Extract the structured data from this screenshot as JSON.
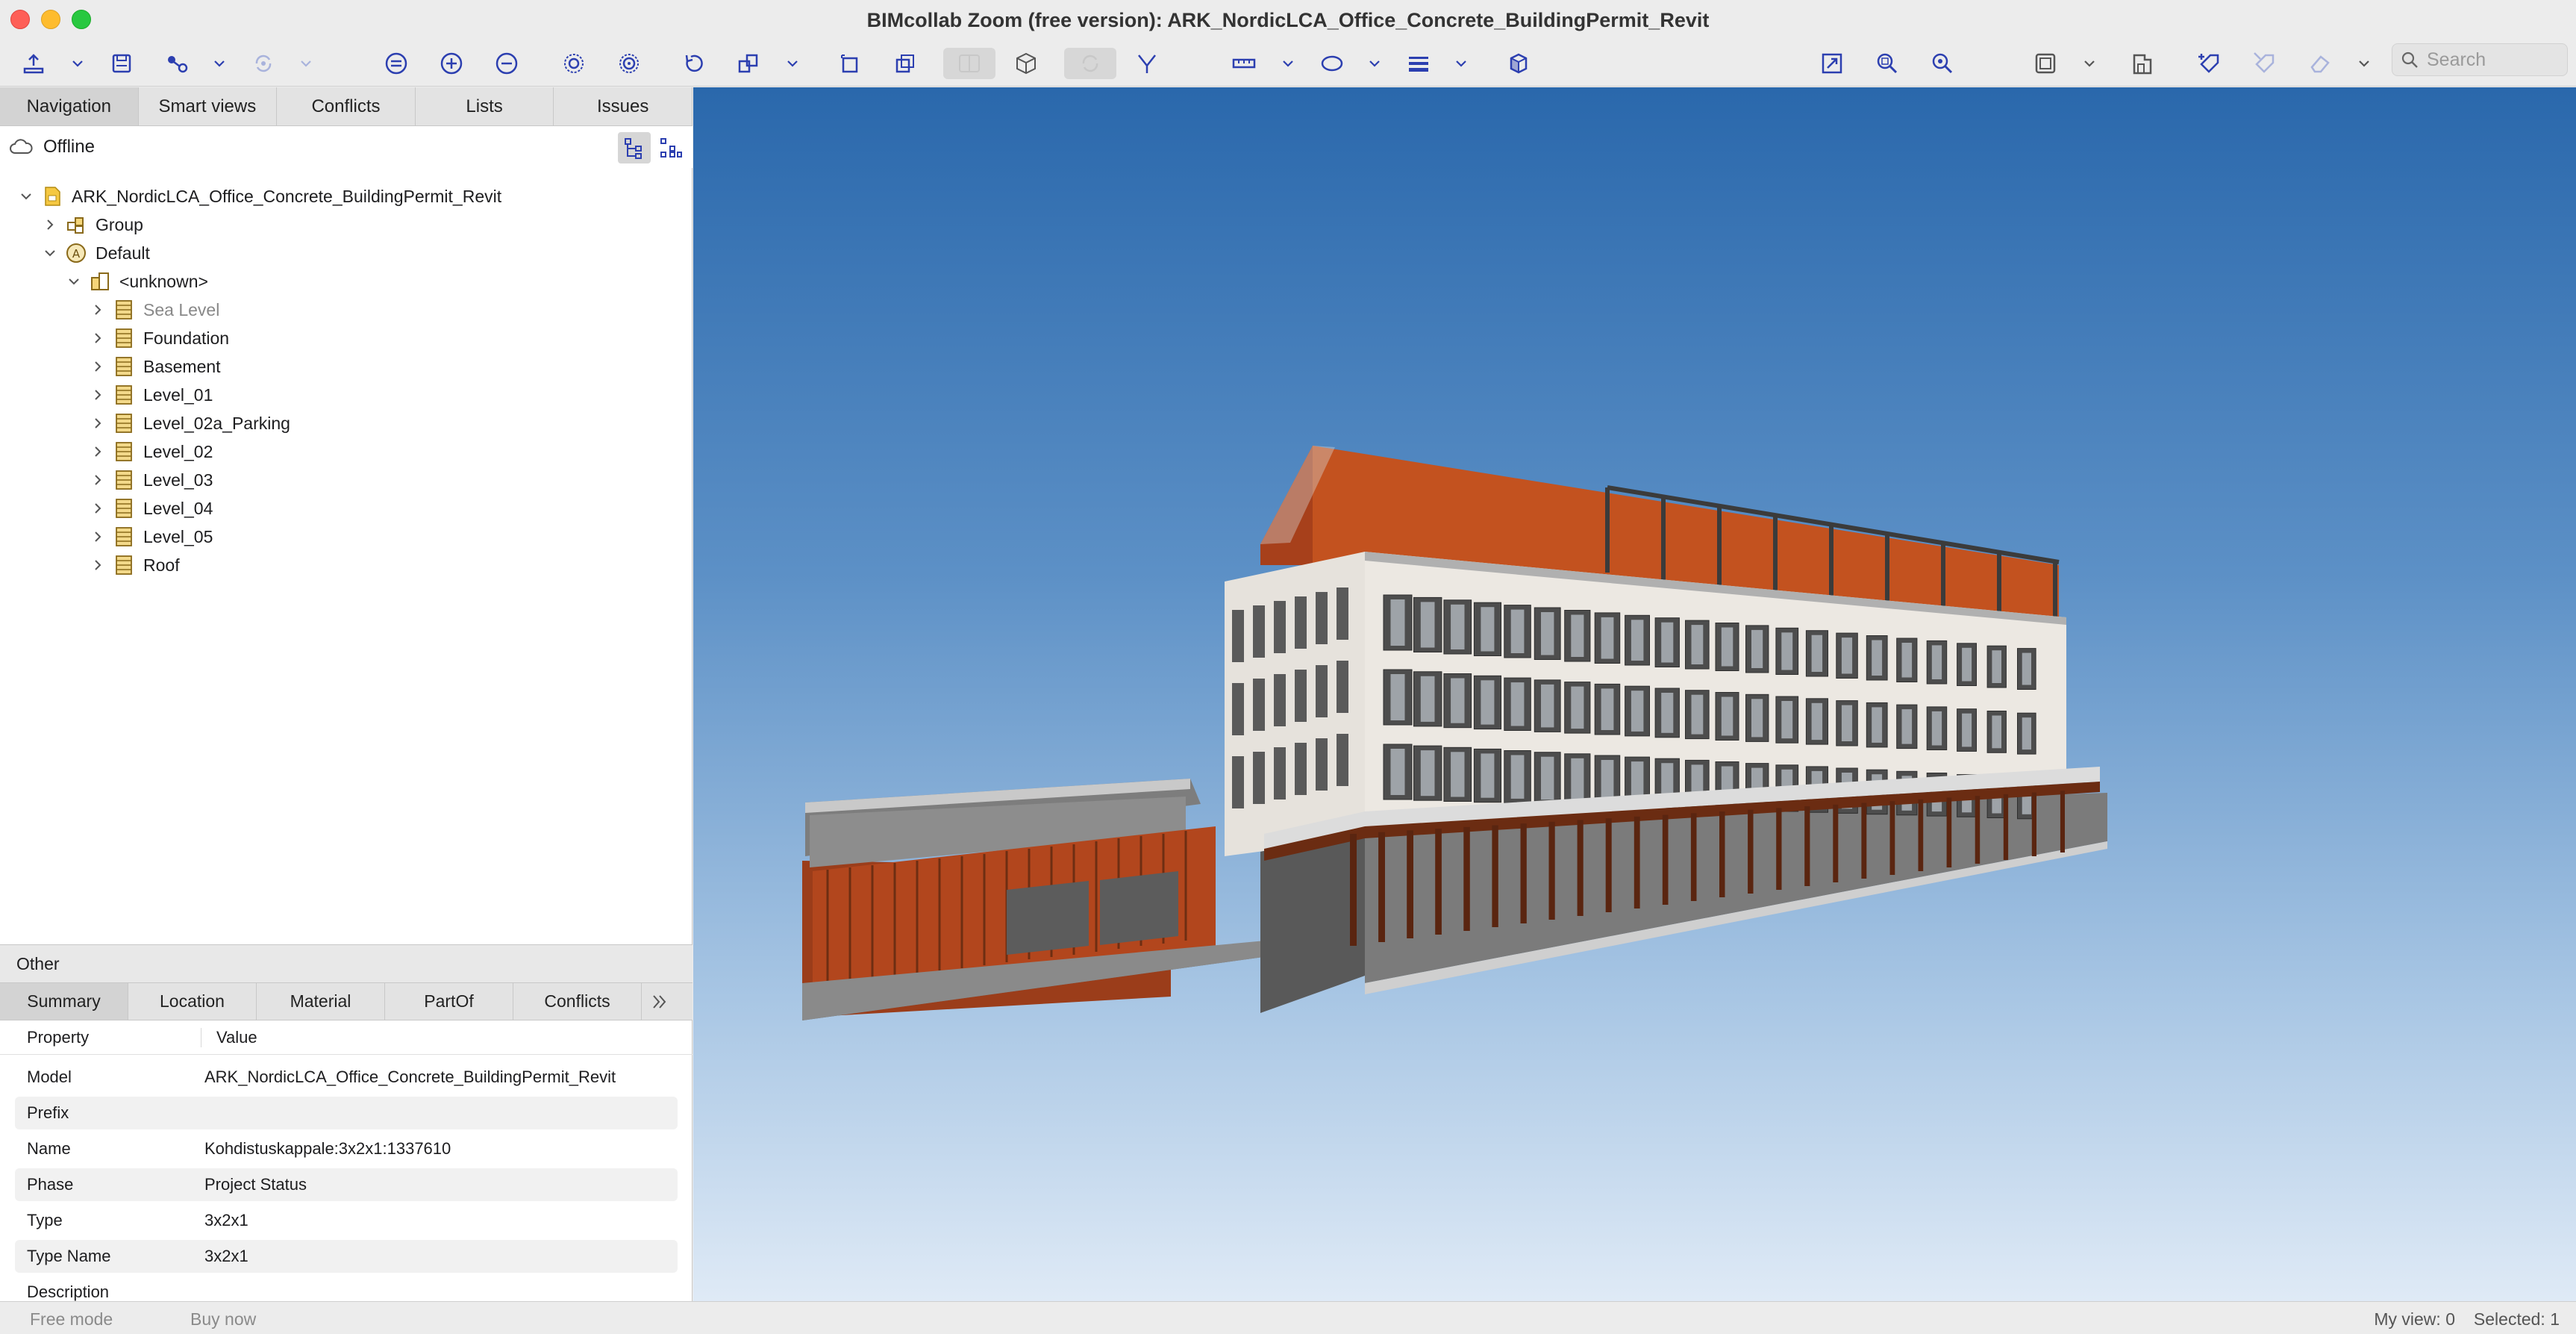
{
  "window": {
    "title": "BIMcollab Zoom (free version): ARK_NordicLCA_Office_Concrete_BuildingPermit_Revit"
  },
  "toolbar": {
    "search_placeholder": "Search",
    "icons": [
      "open-icon",
      "save-icon",
      "connect-icon",
      "sync-icon",
      "visibility-isolate-icon",
      "zoom-in-icon",
      "zoom-out-icon",
      "focus-icon",
      "select-all-icon",
      "reset-icon",
      "layers-icon",
      "box-icon",
      "section-box-icon",
      "plane-icon",
      "cube-icon",
      "orbit-icon",
      "walk-icon",
      "measure-icon",
      "ellipse-icon",
      "lines-icon",
      "render-icon",
      "fullscreen-icon",
      "zoom-selection-icon",
      "zoom-extents-icon",
      "frame-icon",
      "storey-icon",
      "tag-add-icon",
      "tag-remove-icon",
      "erase-icon"
    ]
  },
  "left_panel": {
    "tabs": [
      {
        "label": "Navigation",
        "active": true
      },
      {
        "label": "Smart views",
        "active": false
      },
      {
        "label": "Conflicts",
        "active": false
      },
      {
        "label": "Lists",
        "active": false
      },
      {
        "label": "Issues",
        "active": false
      }
    ],
    "status": "Offline",
    "tree": [
      {
        "label": "ARK_NordicLCA_Office_Concrete_BuildingPermit_Revit",
        "depth": 0,
        "expanded": true,
        "icon": "file-icon"
      },
      {
        "label": "Group",
        "depth": 1,
        "expanded": false,
        "icon": "group-icon"
      },
      {
        "label": "Default",
        "depth": 1,
        "expanded": true,
        "icon": "discipline-a-icon"
      },
      {
        "label": "<unknown>",
        "depth": 2,
        "expanded": true,
        "icon": "building-icon"
      },
      {
        "label": "Sea Level",
        "depth": 3,
        "expanded": false,
        "icon": "storey-icon",
        "muted": true
      },
      {
        "label": "Foundation",
        "depth": 3,
        "expanded": false,
        "icon": "storey-icon"
      },
      {
        "label": "Basement",
        "depth": 3,
        "expanded": false,
        "icon": "storey-icon"
      },
      {
        "label": "Level_01",
        "depth": 3,
        "expanded": false,
        "icon": "storey-icon"
      },
      {
        "label": "Level_02a_Parking",
        "depth": 3,
        "expanded": false,
        "icon": "storey-icon"
      },
      {
        "label": "Level_02",
        "depth": 3,
        "expanded": false,
        "icon": "storey-icon"
      },
      {
        "label": "Level_03",
        "depth": 3,
        "expanded": false,
        "icon": "storey-icon"
      },
      {
        "label": "Level_04",
        "depth": 3,
        "expanded": false,
        "icon": "storey-icon"
      },
      {
        "label": "Level_05",
        "depth": 3,
        "expanded": false,
        "icon": "storey-icon"
      },
      {
        "label": "Roof",
        "depth": 3,
        "expanded": false,
        "icon": "storey-icon"
      }
    ],
    "section_title": "Other",
    "prop_tabs": [
      {
        "label": "Summary",
        "active": true
      },
      {
        "label": "Location",
        "active": false
      },
      {
        "label": "Material",
        "active": false
      },
      {
        "label": "PartOf",
        "active": false
      },
      {
        "label": "Conflicts",
        "active": false
      }
    ],
    "prop_header": {
      "property": "Property",
      "value": "Value"
    },
    "properties": [
      {
        "key": "Model",
        "value": "ARK_NordicLCA_Office_Concrete_BuildingPermit_Revit"
      },
      {
        "key": "Prefix",
        "value": ""
      },
      {
        "key": "Name",
        "value": "Kohdistuskappale:3x2x1:1337610"
      },
      {
        "key": "Phase",
        "value": "Project Status"
      },
      {
        "key": "Type",
        "value": "3x2x1"
      },
      {
        "key": "Type Name",
        "value": "3x2x1"
      },
      {
        "key": "Description",
        "value": ""
      }
    ]
  },
  "statusbar": {
    "left1": "Free mode",
    "left2": "Buy now",
    "my_view": "My view: 0",
    "selected": "Selected: 1"
  },
  "colors": {
    "accent": "#2c3fb0",
    "facade_orange": "#b04a21",
    "sky_top": "#2a68ac",
    "sky_bottom": "#dfeaf6"
  }
}
